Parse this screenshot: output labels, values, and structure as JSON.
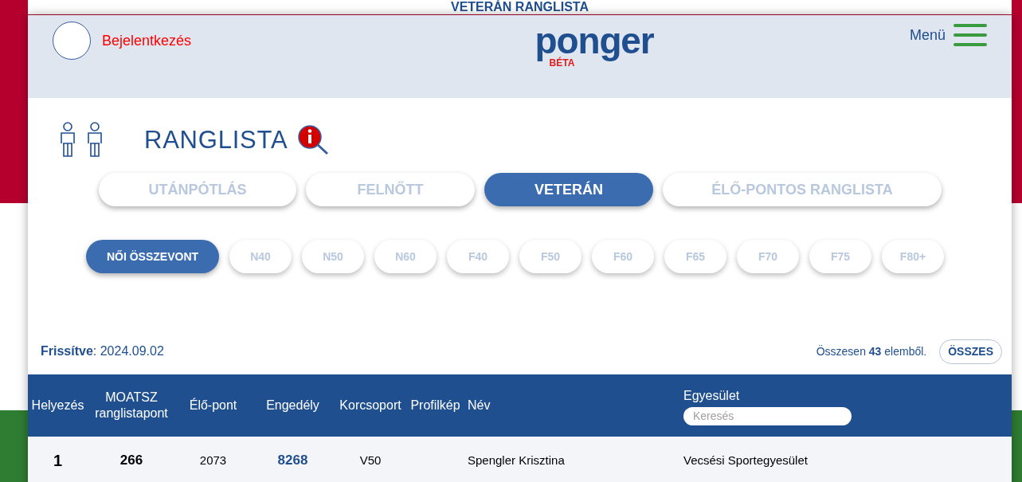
{
  "page_title": "VETERÁN RANGLISTA",
  "header": {
    "login": "Bejelentkezés",
    "logo": "ponger",
    "logo_sub": "BÉTA",
    "menu": "Menü"
  },
  "heading": "RANGLISTA",
  "tabs": [
    {
      "label": "UTÁNPÓTLÁS",
      "selected": false
    },
    {
      "label": "FELNŐTT",
      "selected": false
    },
    {
      "label": "VETERÁN",
      "selected": true
    },
    {
      "label": "ÉLŐ-PONTOS RANGLISTA",
      "selected": false
    }
  ],
  "categories": [
    {
      "label": "NŐI ÖSSZEVONT",
      "selected": true
    },
    {
      "label": "N40",
      "selected": false
    },
    {
      "label": "N50",
      "selected": false
    },
    {
      "label": "N60",
      "selected": false
    },
    {
      "label": "F40",
      "selected": false
    },
    {
      "label": "F50",
      "selected": false
    },
    {
      "label": "F60",
      "selected": false
    },
    {
      "label": "F65",
      "selected": false
    },
    {
      "label": "F70",
      "selected": false
    },
    {
      "label": "F75",
      "selected": false
    },
    {
      "label": "F80+",
      "selected": false
    }
  ],
  "updated": "**Frissítve**: 2024.09.02",
  "total": "Összesen **43** elemből.",
  "all_button": "ÖSSZES",
  "table": {
    "columns": [
      "Helyezés",
      "MOATSZ ranglistapont",
      "Élő-pont",
      "Engedély",
      "Korcsoport",
      "Profilkép",
      "Név",
      "Egyesület"
    ],
    "search_placeholder": "Keresés",
    "rows": [
      {
        "cells": [
          "1",
          "266",
          "2073",
          "8268",
          "V50",
          "",
          "Spengler Krisztina",
          "Vecsési Sportegyesület"
        ]
      }
    ]
  }
}
